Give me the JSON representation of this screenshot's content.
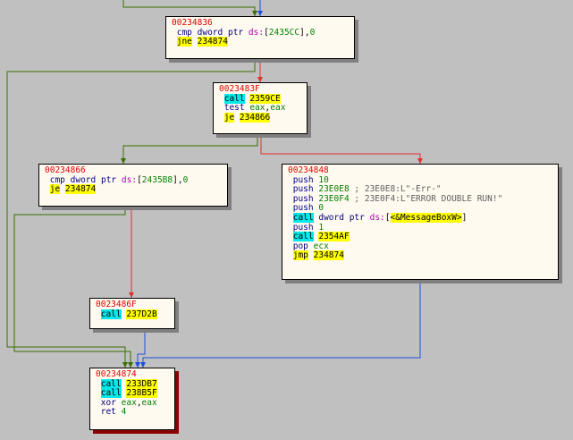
{
  "graph": {
    "blocks": [
      {
        "id": "b00234836",
        "lines": [
          {
            "kind": "addr",
            "text": "00234836"
          },
          {
            "kind": "ins",
            "mn": "cmp",
            "ops": "dword ptr ds:[2435CC],0"
          },
          {
            "kind": "ins",
            "mn": "jne",
            "target": "234874"
          }
        ]
      },
      {
        "id": "b0023483F",
        "lines": [
          {
            "kind": "addr",
            "text": "0023483F"
          },
          {
            "kind": "ins",
            "mn": "call",
            "target": "2359CE"
          },
          {
            "kind": "ins",
            "mn": "test",
            "ops": "eax,eax"
          },
          {
            "kind": "ins",
            "mn": "je",
            "target": "234866"
          }
        ]
      },
      {
        "id": "b00234866",
        "lines": [
          {
            "kind": "addr",
            "text": "00234866"
          },
          {
            "kind": "ins",
            "mn": "cmp",
            "ops": "dword ptr ds:[2435B8],0"
          },
          {
            "kind": "ins",
            "mn": "je",
            "target": "234874"
          }
        ]
      },
      {
        "id": "b00234848",
        "lines": [
          {
            "kind": "addr",
            "text": "00234848"
          },
          {
            "kind": "ins",
            "mn": "push",
            "ops": "10"
          },
          {
            "kind": "ins",
            "mn": "push",
            "ops": "23E0E8 ; 23E0E8:L\"-Err-\""
          },
          {
            "kind": "ins",
            "mn": "push",
            "ops": "23E0F4 ; 23E0F4:L\"ERROR DOUBLE RUN!\""
          },
          {
            "kind": "ins",
            "mn": "push",
            "ops": "0"
          },
          {
            "kind": "ins",
            "mn": "call",
            "ops": "dword ptr ds:[<&MessageBoxW>]"
          },
          {
            "kind": "ins",
            "mn": "push",
            "ops": "1"
          },
          {
            "kind": "ins",
            "mn": "call",
            "target": "2354AF"
          },
          {
            "kind": "ins",
            "mn": "pop",
            "ops": "ecx"
          },
          {
            "kind": "ins",
            "mn": "jmp",
            "target": "234874"
          }
        ]
      },
      {
        "id": "b0023486F",
        "lines": [
          {
            "kind": "addr",
            "text": "0023486F"
          },
          {
            "kind": "ins",
            "mn": "call",
            "target": "237D2B"
          }
        ]
      },
      {
        "id": "b00234874",
        "lines": [
          {
            "kind": "addr",
            "text": "00234874"
          },
          {
            "kind": "ins",
            "mn": "call",
            "target": "233DB7"
          },
          {
            "kind": "ins",
            "mn": "call",
            "target": "238B5F"
          },
          {
            "kind": "ins",
            "mn": "xor",
            "ops": "eax,eax"
          },
          {
            "kind": "ins",
            "mn": "ret",
            "ops": "4"
          }
        ]
      }
    ],
    "edge_colors": {
      "taken": "#3a6e00",
      "not_taken": "#e03030",
      "unconditional": "#1a50e0"
    }
  }
}
